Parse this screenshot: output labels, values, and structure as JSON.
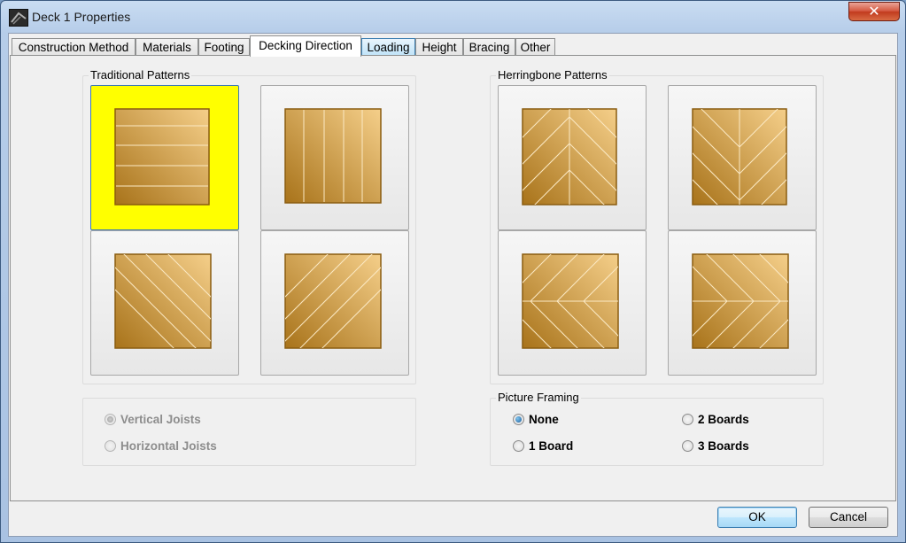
{
  "window": {
    "title": "Deck 1 Properties",
    "close_glyph": "✕",
    "icon": "app-deck-icon"
  },
  "tabs": [
    {
      "label": "Construction Method"
    },
    {
      "label": "Materials"
    },
    {
      "label": "Footing"
    },
    {
      "label": "Decking Direction",
      "active": true
    },
    {
      "label": "Loading",
      "hover": true
    },
    {
      "label": "Height"
    },
    {
      "label": "Bracing"
    },
    {
      "label": "Other"
    }
  ],
  "traditional": {
    "legend": "Traditional Patterns",
    "patterns": [
      "horizontal-boards",
      "vertical-boards",
      "diagonal-left",
      "diagonal-right"
    ],
    "selected": "horizontal-boards",
    "selected_color": "#ffff00"
  },
  "herringbone": {
    "legend": "Herringbone Patterns",
    "patterns": [
      "herringbone-vertical-up",
      "herringbone-vertical-down",
      "herringbone-horizontal-left",
      "herringbone-horizontal-right"
    ]
  },
  "joists": {
    "vertical_label": "Vertical Joists",
    "horizontal_label": "Horizontal Joists",
    "selected": "vertical",
    "enabled": false
  },
  "picture_framing": {
    "legend": "Picture Framing",
    "options": [
      {
        "label": "None",
        "selected": true
      },
      {
        "label": "2 Boards",
        "selected": false
      },
      {
        "label": "1 Board",
        "selected": false
      },
      {
        "label": "3 Boards",
        "selected": false
      }
    ]
  },
  "buttons": {
    "ok": "OK",
    "cancel": "Cancel"
  },
  "colors": {
    "wood_dark": "#a8731a",
    "wood_light": "#f5cf8a",
    "board_line": "#fbe9c4",
    "accent": "#3c7fb1"
  }
}
